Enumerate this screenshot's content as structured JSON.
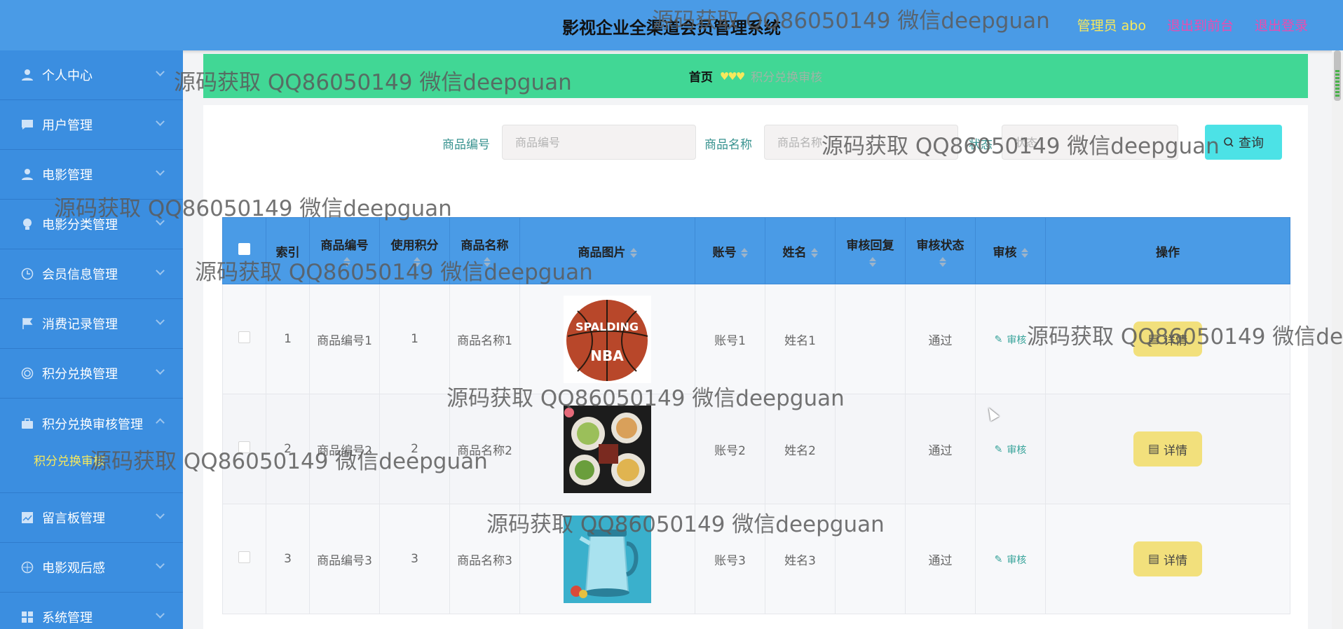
{
  "header": {
    "title": "影视企业全渠道会员管理系统",
    "user": "管理员 abo",
    "to_front": "退出到前台",
    "logout": "退出登录"
  },
  "sidebar": {
    "items": [
      {
        "label": "个人中心",
        "icon": "user-icon"
      },
      {
        "label": "用户管理",
        "icon": "chat-icon"
      },
      {
        "label": "电影管理",
        "icon": "user-icon"
      },
      {
        "label": "电影分类管理",
        "icon": "bulb-icon"
      },
      {
        "label": "会员信息管理",
        "icon": "clock-icon"
      },
      {
        "label": "消费记录管理",
        "icon": "flag-icon"
      },
      {
        "label": "积分兑换管理",
        "icon": "target-icon"
      },
      {
        "label": "积分兑换审核管理",
        "icon": "briefcase-icon",
        "expanded": true,
        "sub": [
          "积分兑换审核"
        ]
      },
      {
        "label": "留言板管理",
        "icon": "chart-icon"
      },
      {
        "label": "电影观后感",
        "icon": "compass-icon"
      },
      {
        "label": "系统管理",
        "icon": "grid-icon"
      }
    ]
  },
  "breadcrumb": {
    "home": "首页",
    "separator": "♥♥♥",
    "current": "积分兑换审核"
  },
  "search": {
    "code_label": "商品编号",
    "code_placeholder": "商品编号",
    "name_label": "商品名称",
    "name_placeholder": "商品名称",
    "status_label": "状态",
    "status_placeholder": "状态",
    "button": "查询"
  },
  "table": {
    "columns": [
      "索引",
      "商品编号",
      "使用积分",
      "商品名称",
      "商品图片",
      "账号",
      "姓名",
      "审核回复",
      "审核状态",
      "审核",
      "操作"
    ],
    "audit_label": "审核",
    "detail_label": "详情",
    "rows": [
      {
        "index": "1",
        "code": "商品编号1",
        "points": "1",
        "name": "商品名称1",
        "image": "basketball",
        "account": "账号1",
        "person": "姓名1",
        "reply": "",
        "status": "通过"
      },
      {
        "index": "2",
        "code": "商品编号2",
        "points": "2",
        "name": "商品名称2",
        "image": "food-bowls",
        "account": "账号2",
        "person": "姓名2",
        "reply": "",
        "status": "通过"
      },
      {
        "index": "3",
        "code": "商品编号3",
        "points": "3",
        "name": "商品名称3",
        "image": "kettle",
        "account": "账号3",
        "person": "姓名3",
        "reply": "",
        "status": "通过"
      }
    ]
  },
  "watermark": "源码获取 QQ86050149 微信deepguan",
  "colors": {
    "header": "#4a9be6",
    "sidebar": "#3b8ee0",
    "breadcrumb": "#41d795",
    "search_button": "#4ce2e6",
    "detail_button": "#f2e07c",
    "accent_yellow": "#f7e95c",
    "accent_pink": "#ea4cb0"
  }
}
